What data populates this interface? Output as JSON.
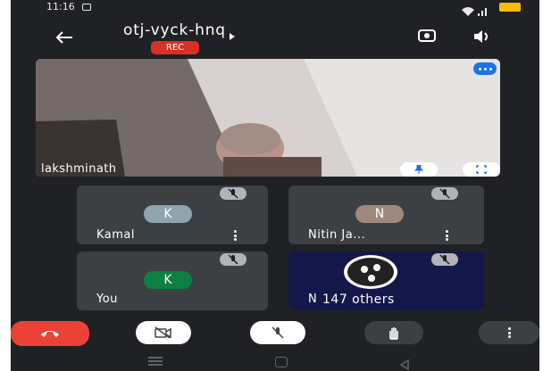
{
  "status_bar": {
    "time": "11:16"
  },
  "header": {
    "meeting_code": "otj-vyck-hnq",
    "rec_badge": "REC"
  },
  "main_video": {
    "name": "lakshminath"
  },
  "participants": [
    {
      "name": "Kamal",
      "initial": "K",
      "avatar_color": "#90a4ae"
    },
    {
      "name": "Nitin Ja...",
      "initial": "N",
      "avatar_color": "#a1887f"
    },
    {
      "name": "You",
      "initial": "K",
      "avatar_color": "#0b8043"
    }
  ],
  "others_tile": {
    "name_prefix": "N",
    "others_label": "147 others"
  },
  "colors": {
    "background": "#202124",
    "tile": "#3c4043",
    "rec": "#d93025",
    "end_call": "#ea4335",
    "accent_blue": "#1a73e8"
  },
  "icons": [
    "back-arrow-icon",
    "camera-switch-icon",
    "speaker-icon",
    "more-options-icon",
    "pin-icon",
    "fullscreen-icon",
    "mic-off-icon",
    "end-call-icon",
    "camera-off-icon",
    "raise-hand-icon",
    "kebab-icon",
    "obs-logo-icon"
  ]
}
